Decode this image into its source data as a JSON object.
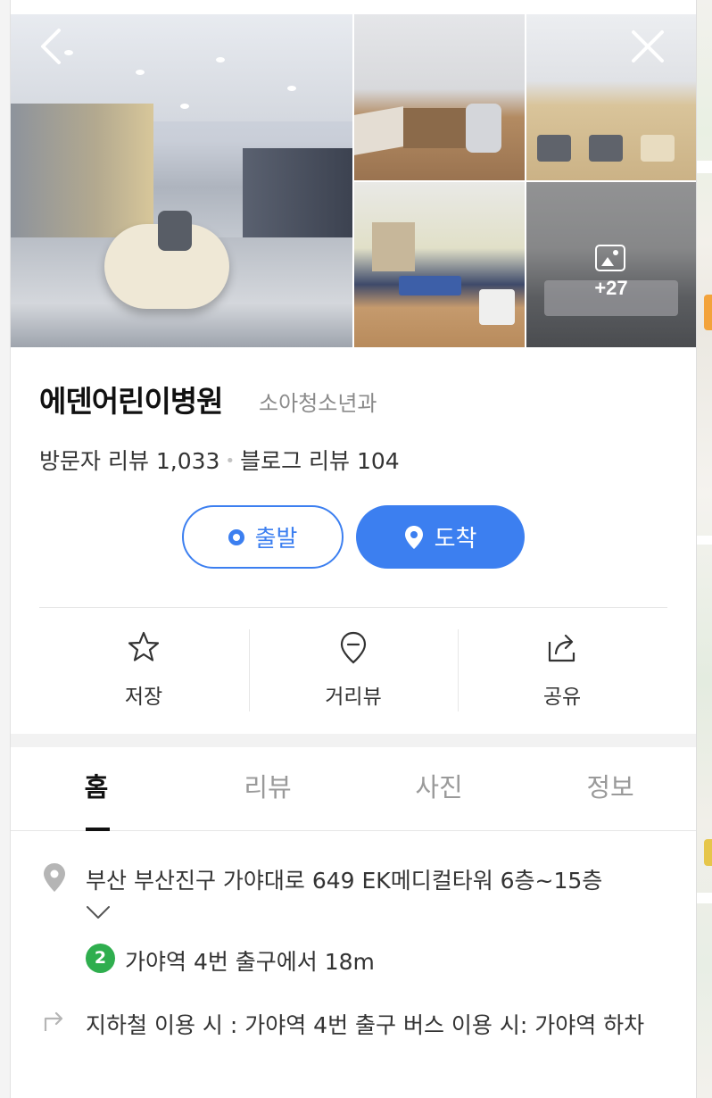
{
  "gallery": {
    "more_count": "+27",
    "back_icon": "chevron-left-icon",
    "close_icon": "close-icon",
    "photo_icon": "image-icon"
  },
  "place": {
    "name": "에덴어린이병원",
    "category": "소아청소년과",
    "visitor_reviews": "방문자 리뷰 1,033",
    "separator": "•",
    "blog_reviews": "블로그 리뷰 104"
  },
  "route": {
    "start_label": "출발",
    "arrive_label": "도착",
    "accent_color": "#3c7ff0"
  },
  "actions": [
    {
      "label": "저장",
      "icon": "star-icon"
    },
    {
      "label": "거리뷰",
      "icon": "street-view-icon"
    },
    {
      "label": "공유",
      "icon": "share-icon"
    }
  ],
  "tabs": [
    {
      "label": "홈",
      "active": true
    },
    {
      "label": "리뷰",
      "active": false
    },
    {
      "label": "사진",
      "active": false
    },
    {
      "label": "정보",
      "active": false
    }
  ],
  "info": {
    "address": "부산 부산진구 가야대로 649 EK메디컬타워 6층~15층",
    "subway_line": "2",
    "subway_line_color": "#2fae4e",
    "subway_text": "가야역 4번 출구에서 18m",
    "directions": "지하철 이용 시 : 가야역 4번 출구 버스 이용 시: 가야역 하차"
  }
}
